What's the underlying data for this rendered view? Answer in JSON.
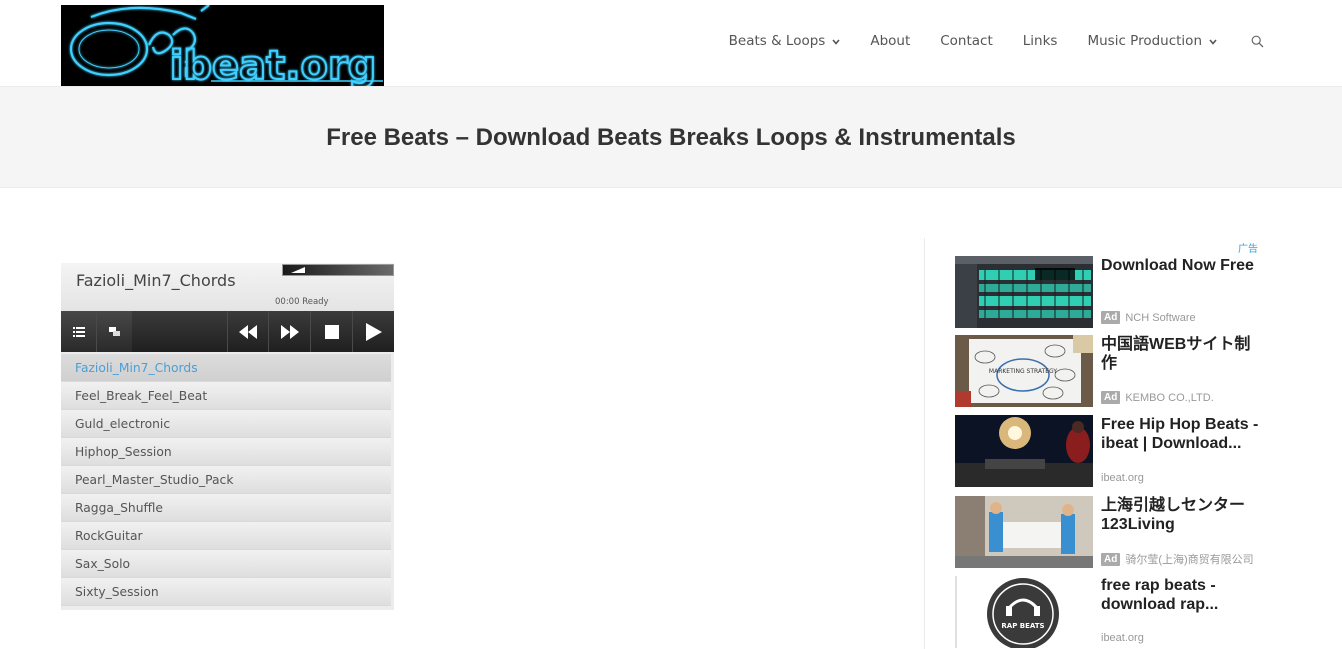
{
  "site": {
    "logo_text": "ibeat.org",
    "colors": {
      "accent_link": "#4a9fd6",
      "ad_label": "#3aa0d8",
      "logo_glow": "#3fd0ff"
    }
  },
  "nav": {
    "items": [
      {
        "label": "Beats & Loops",
        "has_dropdown": true
      },
      {
        "label": "About",
        "has_dropdown": false
      },
      {
        "label": "Contact",
        "has_dropdown": false
      },
      {
        "label": "Links",
        "has_dropdown": false
      },
      {
        "label": "Music Production",
        "has_dropdown": true
      }
    ],
    "search_icon": "search-icon"
  },
  "page": {
    "title": "Free Beats – Download Beats Breaks Loops & Instrumentals"
  },
  "player": {
    "current_track": "Fazioli_Min7_Chords",
    "status": "00:00 Ready",
    "volume_fraction": 0.25,
    "icons": [
      "playlist-icon",
      "popout-icon",
      "rewind-icon",
      "fast-forward-icon",
      "stop-icon",
      "play-icon"
    ],
    "playlist": [
      "Fazioli_Min7_Chords",
      "Feel_Break_Feel_Beat",
      "Guld_electronic",
      "Hiphop_Session",
      "Pearl_Master_Studio_Pack",
      "Ragga_Shuffle",
      "RockGuitar",
      "Sax_Solo",
      "Sixty_Session"
    ]
  },
  "ads": {
    "label": "广告",
    "badge": "Ad",
    "items": [
      {
        "headline": "Download Now Free",
        "source": "NCH Software",
        "has_badge": true
      },
      {
        "headline": "中国語WEBサイト制作",
        "source": "KEMBO CO.,LTD.",
        "has_badge": true
      },
      {
        "headline": "Free Hip Hop Beats - ibeat | Download...",
        "source": "ibeat.org",
        "has_badge": false
      },
      {
        "headline": "上海引越しセンター123Living",
        "source": "骑尔莹(上海)商贸有限公司",
        "has_badge": true
      },
      {
        "headline": "free rap beats - download rap...",
        "source": "ibeat.org",
        "has_badge": false
      }
    ],
    "thumb_texts": {
      "rap_badge": "RAP BEATS",
      "marketing_board": "MARKETING STRATEGY"
    }
  }
}
